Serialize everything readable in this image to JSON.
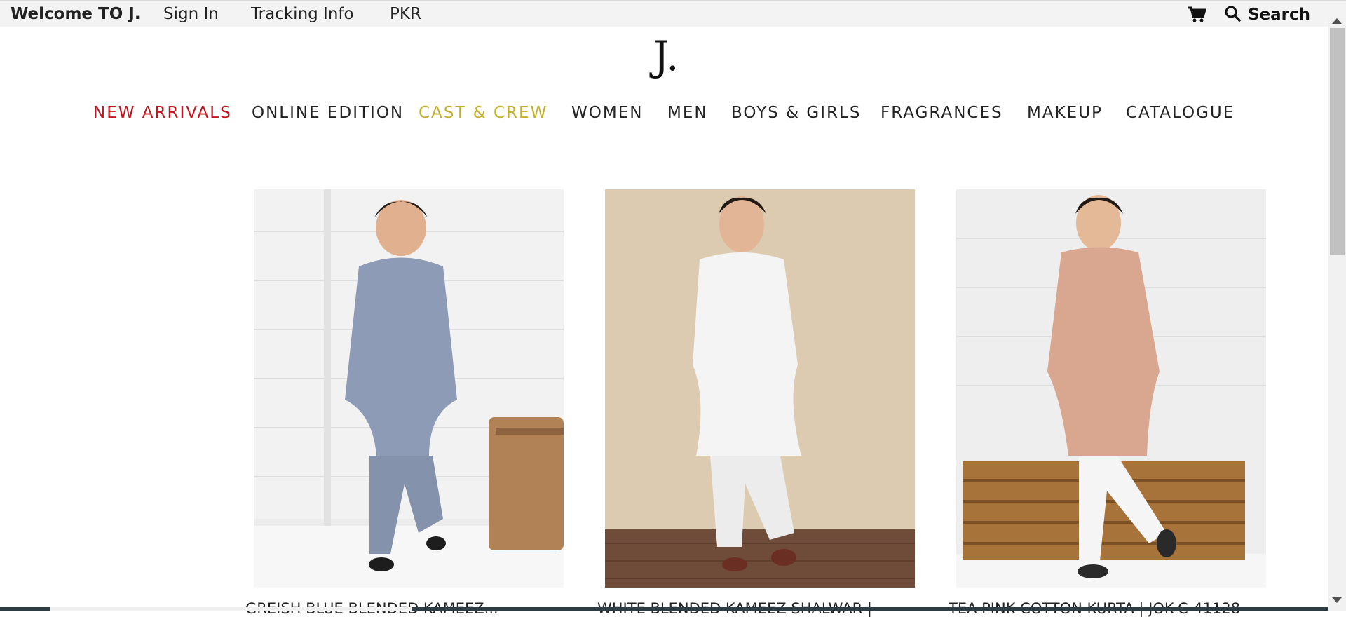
{
  "topbar": {
    "welcome": "Welcome TO J.",
    "signin": "Sign In",
    "tracking": "Tracking Info",
    "currency": "PKR",
    "cart_icon": "cart-icon",
    "search_icon": "search-icon",
    "search_label": "Search"
  },
  "logo": {
    "text": "J."
  },
  "nav": {
    "items": [
      {
        "label": "NEW ARRIVALS",
        "color": "#c4151c"
      },
      {
        "label": "ONLINE EDITION"
      },
      {
        "label": "CAST & CREW",
        "color": "#c2b02a"
      },
      {
        "label": "WOMEN"
      },
      {
        "label": "MEN"
      },
      {
        "label": "BOYS & GIRLS"
      },
      {
        "label": "FRAGRANCES"
      },
      {
        "label": "MAKEUP"
      },
      {
        "label": "CATALOGUE"
      }
    ]
  },
  "products": [
    {
      "title": "GREISH BLUE BLENDED KAMEEZ...",
      "color": "#8d9bb6"
    },
    {
      "title": "WHITE BLENDED KAMEEZ SHALWAR |",
      "color": "#f2f2f2"
    },
    {
      "title": "TEA PINK COTTON KURTA | JOK-C-41128",
      "color": "#d9a78f"
    }
  ]
}
